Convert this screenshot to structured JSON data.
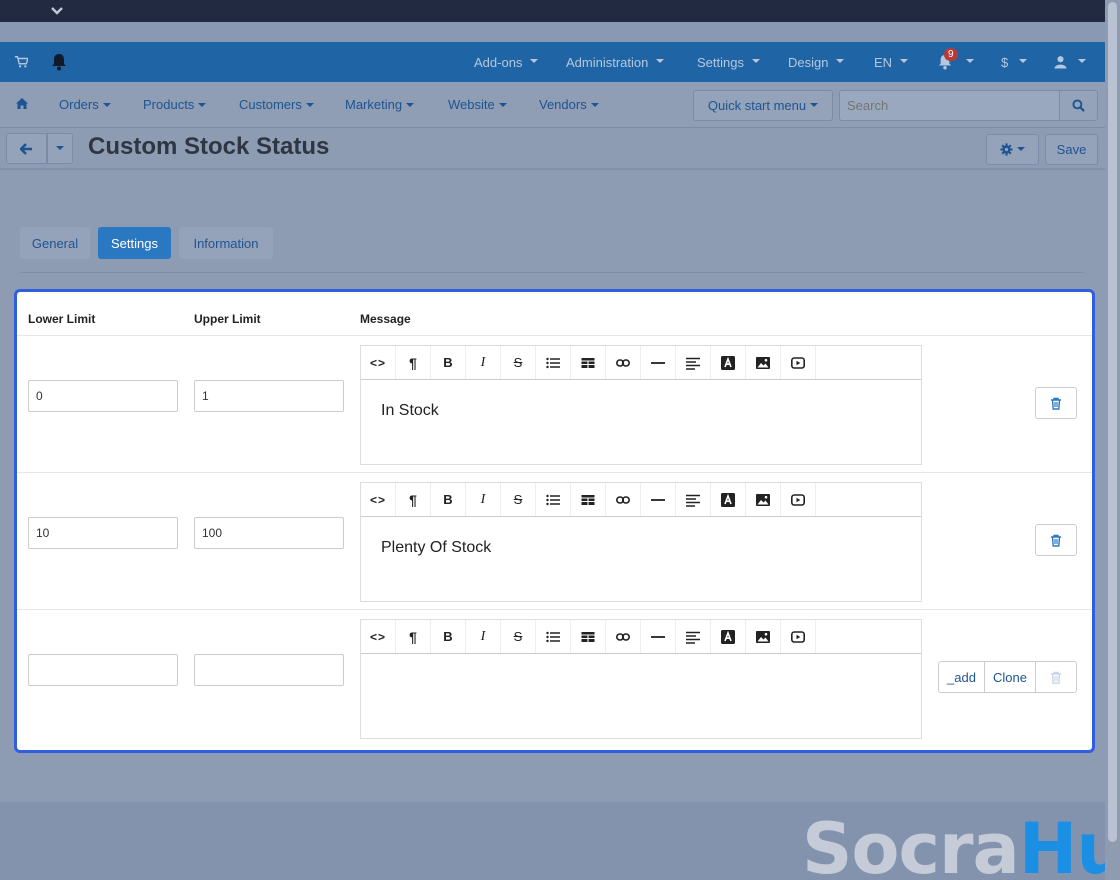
{
  "navbar": {
    "menus": [
      "Add-ons",
      "Administration",
      "Settings",
      "Design",
      "EN"
    ],
    "notification_count": "9",
    "currency": "$",
    "colors": {
      "bg": "#1f65a6",
      "badge": "#b73a3a"
    }
  },
  "subnav": {
    "items": [
      "Orders",
      "Products",
      "Customers",
      "Marketing",
      "Website",
      "Vendors"
    ],
    "quick_start": "Quick start menu",
    "search_placeholder": "Search"
  },
  "page": {
    "title": "Custom Stock Status",
    "save": "Save"
  },
  "tabs": [
    "General",
    "Settings",
    "Information"
  ],
  "table": {
    "headers": [
      "Lower Limit",
      "Upper Limit",
      "Message"
    ],
    "rows": [
      {
        "lower": "0",
        "upper": "1",
        "message": "In Stock"
      },
      {
        "lower": "10",
        "upper": "100",
        "message": "Plenty Of Stock"
      },
      {
        "lower": "",
        "upper": "",
        "message": ""
      }
    ],
    "add_label": "_add",
    "clone_label": "Clone"
  },
  "toolbar_icons": [
    "code-view-icon",
    "paragraph-icon",
    "bold-icon",
    "italic-icon",
    "strikethrough-icon",
    "bullet-list-icon",
    "table-icon",
    "link-icon",
    "horizontal-rule-icon",
    "align-icon",
    "font-color-icon",
    "image-icon",
    "video-icon"
  ],
  "toolbar_glyphs": [
    "<>",
    "¶",
    "B",
    "I",
    "S",
    "",
    "",
    "",
    "",
    "",
    "A",
    "",
    ""
  ],
  "watermark": {
    "part1": "Socra",
    "part2": "Hub",
    "color1": "#c5ccd8",
    "color2": "#1a8fe3"
  },
  "accent": "#2a78c2"
}
